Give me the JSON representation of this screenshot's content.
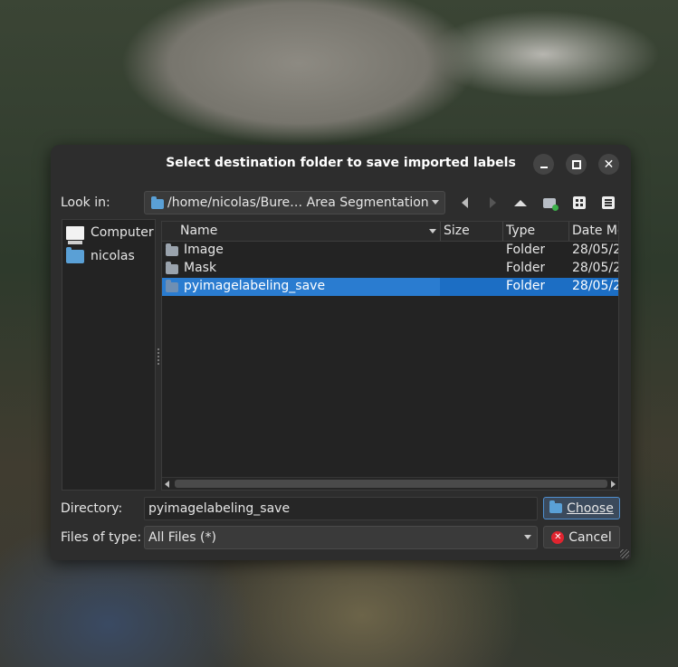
{
  "dialog": {
    "title": "Select destination folder to save imported labels"
  },
  "toolbar": {
    "look_in_label": "Look in:",
    "path": "/home/nicolas/Bure… Area Segmentation"
  },
  "sidebar": {
    "items": [
      {
        "label": "Computer",
        "icon": "computer-icon"
      },
      {
        "label": "nicolas",
        "icon": "folder-icon"
      }
    ]
  },
  "columns": [
    "Name",
    "Size",
    "Type",
    "Date Mo"
  ],
  "files": [
    {
      "name": "Image",
      "size": "",
      "type": "Folder",
      "date": "28/05/2"
    },
    {
      "name": "Mask",
      "size": "",
      "type": "Folder",
      "date": "28/05/2"
    },
    {
      "name": "pyimagelabeling_save",
      "size": "",
      "type": "Folder",
      "date": "28/05/2",
      "selected": true
    }
  ],
  "footer": {
    "directory_label": "Directory:",
    "directory_value": "pyimagelabeling_save",
    "filetype_label": "Files of type:",
    "filetype_value": "All Files (*)",
    "choose_label": "Choose",
    "cancel_label": "Cancel"
  },
  "colors": {
    "selection": "#1c6ec4",
    "accent_folder": "#5aa0d6",
    "cancel_icon": "#e0242f"
  }
}
